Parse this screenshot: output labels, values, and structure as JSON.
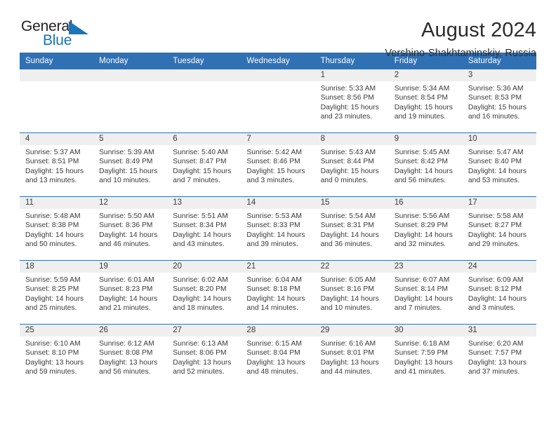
{
  "brand": {
    "name_part1": "General",
    "name_part2": "Blue",
    "triangle_color": "#1b75bb",
    "text_color": "#231f20"
  },
  "header": {
    "title": "August 2024",
    "subtitle": "Vershino-Shakhtaminskiy, Russia"
  },
  "theme": {
    "header_blue": "#3071b4",
    "daynum_band": "#efefef",
    "text": "#3a3a3a"
  },
  "calendar": {
    "weekday_headers": [
      "Sunday",
      "Monday",
      "Tuesday",
      "Wednesday",
      "Thursday",
      "Friday",
      "Saturday"
    ],
    "weeks": [
      [
        {
          "day": "",
          "lines": []
        },
        {
          "day": "",
          "lines": []
        },
        {
          "day": "",
          "lines": []
        },
        {
          "day": "",
          "lines": []
        },
        {
          "day": "1",
          "lines": [
            "Sunrise: 5:33 AM",
            "Sunset: 8:56 PM",
            "Daylight: 15 hours and 23 minutes."
          ]
        },
        {
          "day": "2",
          "lines": [
            "Sunrise: 5:34 AM",
            "Sunset: 8:54 PM",
            "Daylight: 15 hours and 19 minutes."
          ]
        },
        {
          "day": "3",
          "lines": [
            "Sunrise: 5:36 AM",
            "Sunset: 8:53 PM",
            "Daylight: 15 hours and 16 minutes."
          ]
        }
      ],
      [
        {
          "day": "4",
          "lines": [
            "Sunrise: 5:37 AM",
            "Sunset: 8:51 PM",
            "Daylight: 15 hours and 13 minutes."
          ]
        },
        {
          "day": "5",
          "lines": [
            "Sunrise: 5:39 AM",
            "Sunset: 8:49 PM",
            "Daylight: 15 hours and 10 minutes."
          ]
        },
        {
          "day": "6",
          "lines": [
            "Sunrise: 5:40 AM",
            "Sunset: 8:47 PM",
            "Daylight: 15 hours and 7 minutes."
          ]
        },
        {
          "day": "7",
          "lines": [
            "Sunrise: 5:42 AM",
            "Sunset: 8:46 PM",
            "Daylight: 15 hours and 3 minutes."
          ]
        },
        {
          "day": "8",
          "lines": [
            "Sunrise: 5:43 AM",
            "Sunset: 8:44 PM",
            "Daylight: 15 hours and 0 minutes."
          ]
        },
        {
          "day": "9",
          "lines": [
            "Sunrise: 5:45 AM",
            "Sunset: 8:42 PM",
            "Daylight: 14 hours and 56 minutes."
          ]
        },
        {
          "day": "10",
          "lines": [
            "Sunrise: 5:47 AM",
            "Sunset: 8:40 PM",
            "Daylight: 14 hours and 53 minutes."
          ]
        }
      ],
      [
        {
          "day": "11",
          "lines": [
            "Sunrise: 5:48 AM",
            "Sunset: 8:38 PM",
            "Daylight: 14 hours and 50 minutes."
          ]
        },
        {
          "day": "12",
          "lines": [
            "Sunrise: 5:50 AM",
            "Sunset: 8:36 PM",
            "Daylight: 14 hours and 46 minutes."
          ]
        },
        {
          "day": "13",
          "lines": [
            "Sunrise: 5:51 AM",
            "Sunset: 8:34 PM",
            "Daylight: 14 hours and 43 minutes."
          ]
        },
        {
          "day": "14",
          "lines": [
            "Sunrise: 5:53 AM",
            "Sunset: 8:33 PM",
            "Daylight: 14 hours and 39 minutes."
          ]
        },
        {
          "day": "15",
          "lines": [
            "Sunrise: 5:54 AM",
            "Sunset: 8:31 PM",
            "Daylight: 14 hours and 36 minutes."
          ]
        },
        {
          "day": "16",
          "lines": [
            "Sunrise: 5:56 AM",
            "Sunset: 8:29 PM",
            "Daylight: 14 hours and 32 minutes."
          ]
        },
        {
          "day": "17",
          "lines": [
            "Sunrise: 5:58 AM",
            "Sunset: 8:27 PM",
            "Daylight: 14 hours and 29 minutes."
          ]
        }
      ],
      [
        {
          "day": "18",
          "lines": [
            "Sunrise: 5:59 AM",
            "Sunset: 8:25 PM",
            "Daylight: 14 hours and 25 minutes."
          ]
        },
        {
          "day": "19",
          "lines": [
            "Sunrise: 6:01 AM",
            "Sunset: 8:23 PM",
            "Daylight: 14 hours and 21 minutes."
          ]
        },
        {
          "day": "20",
          "lines": [
            "Sunrise: 6:02 AM",
            "Sunset: 8:20 PM",
            "Daylight: 14 hours and 18 minutes."
          ]
        },
        {
          "day": "21",
          "lines": [
            "Sunrise: 6:04 AM",
            "Sunset: 8:18 PM",
            "Daylight: 14 hours and 14 minutes."
          ]
        },
        {
          "day": "22",
          "lines": [
            "Sunrise: 6:05 AM",
            "Sunset: 8:16 PM",
            "Daylight: 14 hours and 10 minutes."
          ]
        },
        {
          "day": "23",
          "lines": [
            "Sunrise: 6:07 AM",
            "Sunset: 8:14 PM",
            "Daylight: 14 hours and 7 minutes."
          ]
        },
        {
          "day": "24",
          "lines": [
            "Sunrise: 6:09 AM",
            "Sunset: 8:12 PM",
            "Daylight: 14 hours and 3 minutes."
          ]
        }
      ],
      [
        {
          "day": "25",
          "lines": [
            "Sunrise: 6:10 AM",
            "Sunset: 8:10 PM",
            "Daylight: 13 hours and 59 minutes."
          ]
        },
        {
          "day": "26",
          "lines": [
            "Sunrise: 6:12 AM",
            "Sunset: 8:08 PM",
            "Daylight: 13 hours and 56 minutes."
          ]
        },
        {
          "day": "27",
          "lines": [
            "Sunrise: 6:13 AM",
            "Sunset: 8:06 PM",
            "Daylight: 13 hours and 52 minutes."
          ]
        },
        {
          "day": "28",
          "lines": [
            "Sunrise: 6:15 AM",
            "Sunset: 8:04 PM",
            "Daylight: 13 hours and 48 minutes."
          ]
        },
        {
          "day": "29",
          "lines": [
            "Sunrise: 6:16 AM",
            "Sunset: 8:01 PM",
            "Daylight: 13 hours and 44 minutes."
          ]
        },
        {
          "day": "30",
          "lines": [
            "Sunrise: 6:18 AM",
            "Sunset: 7:59 PM",
            "Daylight: 13 hours and 41 minutes."
          ]
        },
        {
          "day": "31",
          "lines": [
            "Sunrise: 6:20 AM",
            "Sunset: 7:57 PM",
            "Daylight: 13 hours and 37 minutes."
          ]
        }
      ]
    ]
  }
}
